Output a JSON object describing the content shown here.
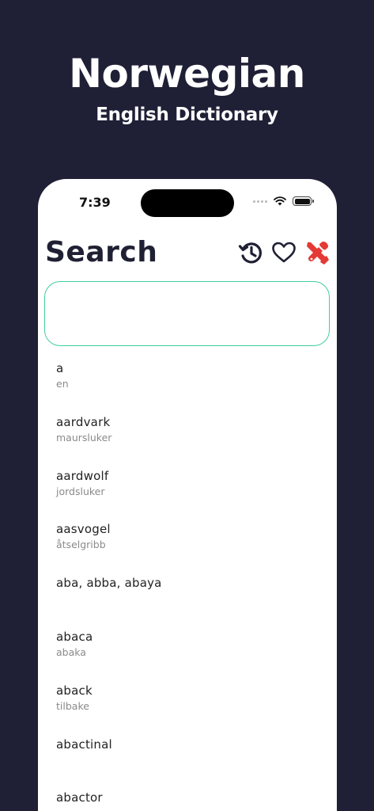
{
  "promo": {
    "title": "Norwegian",
    "subtitle": "English Dictionary"
  },
  "status_bar": {
    "time": "7:39"
  },
  "header": {
    "title": "Search",
    "icons": [
      "history-icon",
      "heart-icon",
      "tools-icon"
    ],
    "tools_color": "#e53935"
  },
  "search": {
    "value": "",
    "placeholder": "",
    "border_color": "#3fcf9a"
  },
  "words": [
    {
      "en": "a",
      "no": "en"
    },
    {
      "en": "aardvark",
      "no": "maursluker"
    },
    {
      "en": "aardwolf",
      "no": "jordsluker"
    },
    {
      "en": "aasvogel",
      "no": "åtselgribb"
    },
    {
      "en": "aba, abba, abaya",
      "no": ""
    },
    {
      "en": "abaca",
      "no": "abaka"
    },
    {
      "en": "aback",
      "no": "tilbake"
    },
    {
      "en": "abactinal",
      "no": ""
    },
    {
      "en": "abactor",
      "no": ""
    }
  ]
}
